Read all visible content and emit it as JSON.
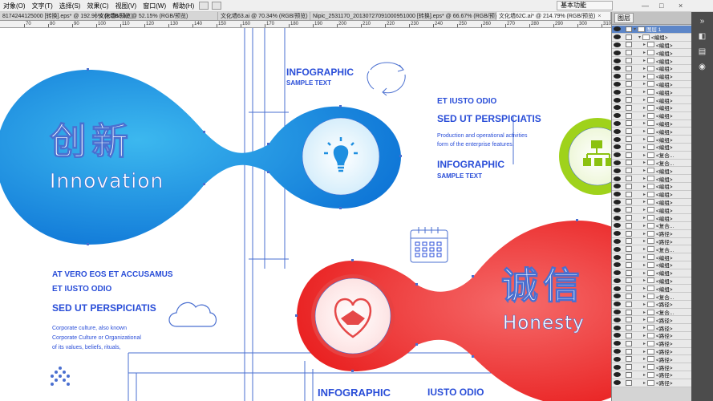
{
  "menubar": {
    "items": [
      "对象(O)",
      "文字(T)",
      "选择(S)",
      "效果(C)",
      "视图(V)",
      "窗口(W)",
      "帮助(H)"
    ],
    "workspace": "基本功能",
    "win_minimize": "—",
    "win_restore": "□",
    "win_close": "×"
  },
  "tabs": [
    {
      "label": "8174244125000 [转换].eps* @ 192.96% (RGB/预览)"
    },
    {
      "label": "文化墙63.ai* @ 52.15% (RGB/预览)"
    },
    {
      "label": "文化墙63.ai @ 70.34% (RGB/预览)"
    },
    {
      "label": "Nipic_2531170_20130727091000951000 [转换].eps* @ 66.67% (RGB/预览)"
    },
    {
      "label": "文化墙62C.ai* @ 214.79% (RGB/预览)",
      "active": true
    }
  ],
  "ruler": {
    "labels": [
      "70",
      "80",
      "90",
      "100",
      "110",
      "120",
      "130",
      "140",
      "150",
      "160",
      "170",
      "180",
      "190",
      "200",
      "210",
      "220",
      "230",
      "240",
      "250",
      "260",
      "270",
      "280",
      "290",
      "300",
      "310"
    ]
  },
  "artwork": {
    "innovation_title": "创新",
    "innovation_sub": "Innovation",
    "honesty_title": "诚信",
    "honesty_sub": "Honesty",
    "infographic_1": "INFOGRAPHIC",
    "sample_1": "SAMPLE TEXT",
    "iusto_1": "ET IUSTO ODIO",
    "perspiciatis_1": "SED UT PERSPICIATIS",
    "desc_1a": "Production and operational activities",
    "desc_1b": "form of the enterprise features.",
    "infographic_2": "INFOGRAPHIC",
    "sample_2": "SAMPLE TEXT",
    "vero": "AT VERO EOS ET ACCUSAMUS",
    "iusto_2": "ET IUSTO ODIO",
    "perspiciatis_2": "SED UT PERSPICIATIS",
    "desc_2a": "Corporate culture, also known",
    "desc_2b": "Corporate Culture or Organizational",
    "desc_2c": "of its values, beliefs, rituals,",
    "infographic_3": "INFOGRAPHIC",
    "iusto_3": "IUSTO ODIO",
    "colors": {
      "blue_start": "#0a6fd4",
      "blue_end": "#3cb8ef",
      "red_start": "#e60d0d",
      "red_end": "#f76b6b",
      "green": "#9fd21b",
      "guide": "#4a6fd0",
      "text_blue": "#2a4ed8"
    }
  },
  "layers_panel": {
    "tab_label": "图层",
    "menu_icon": "≡",
    "rows": [
      {
        "name": "图层 1",
        "level": 0,
        "selected": true
      },
      {
        "name": "<编组>",
        "level": 1
      },
      {
        "name": "<编组>",
        "level": 2
      },
      {
        "name": "<编组>",
        "level": 2
      },
      {
        "name": "<编组>",
        "level": 2
      },
      {
        "name": "<编组>",
        "level": 2
      },
      {
        "name": "<编组>",
        "level": 2
      },
      {
        "name": "<编组>",
        "level": 2
      },
      {
        "name": "<编组>",
        "level": 2
      },
      {
        "name": "<编组>",
        "level": 2
      },
      {
        "name": "<编组>",
        "level": 2
      },
      {
        "name": "<编组>",
        "level": 2
      },
      {
        "name": "<编组>",
        "level": 2
      },
      {
        "name": "<编组>",
        "level": 2
      },
      {
        "name": "<编组>",
        "level": 2
      },
      {
        "name": "<编组>",
        "level": 2
      },
      {
        "name": "<复合...",
        "level": 2
      },
      {
        "name": "<复合...",
        "level": 2
      },
      {
        "name": "<编组>",
        "level": 2
      },
      {
        "name": "<编组>",
        "level": 2
      },
      {
        "name": "<编组>",
        "level": 2
      },
      {
        "name": "<编组>",
        "level": 2
      },
      {
        "name": "<编组>",
        "level": 2
      },
      {
        "name": "<编组>",
        "level": 2
      },
      {
        "name": "<编组>",
        "level": 2
      },
      {
        "name": "<复合...",
        "level": 2
      },
      {
        "name": "<路径>",
        "level": 2
      },
      {
        "name": "<路径>",
        "level": 2
      },
      {
        "name": "<复合...",
        "level": 2
      },
      {
        "name": "<编组>",
        "level": 2
      },
      {
        "name": "<编组>",
        "level": 2
      },
      {
        "name": "<编组>",
        "level": 2
      },
      {
        "name": "<编组>",
        "level": 2
      },
      {
        "name": "<编组>",
        "level": 2
      },
      {
        "name": "<复合...",
        "level": 2
      },
      {
        "name": "<路径>",
        "level": 2
      },
      {
        "name": "<复合...",
        "level": 2
      },
      {
        "name": "<路径>",
        "level": 2
      },
      {
        "name": "<路径>",
        "level": 2
      },
      {
        "name": "<路径>",
        "level": 2
      },
      {
        "name": "<路径>",
        "level": 2
      },
      {
        "name": "<路径>",
        "level": 2
      },
      {
        "name": "<路径>",
        "level": 2
      },
      {
        "name": "<路径>",
        "level": 2
      },
      {
        "name": "<路径>",
        "level": 2
      },
      {
        "name": "<路径>",
        "level": 2
      }
    ]
  },
  "dock": {
    "icons": [
      "»",
      "◧",
      "▤",
      "◉"
    ]
  }
}
